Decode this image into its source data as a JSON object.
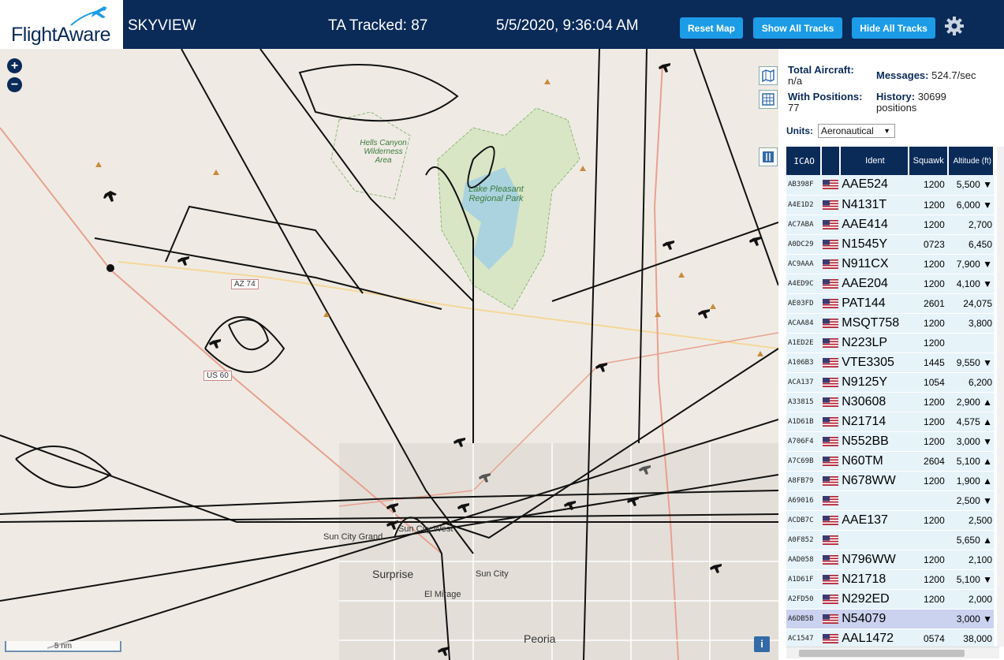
{
  "header": {
    "logo_text": "FlightAware",
    "app_title": "SKYVIEW",
    "tracked": "TA Tracked: 87",
    "clock": "5/5/2020, 9:36:04 AM",
    "buttons": {
      "reset": "Reset Map",
      "show_all": "Show All Tracks",
      "hide_all": "Hide All Tracks"
    }
  },
  "map": {
    "zoom_in": "+",
    "zoom_out": "−",
    "scale": "5 nm",
    "info": "i",
    "labels": {
      "hells_canyon": "Hells Canyon Wilderness Area",
      "lake_pleasant": "Lake Pleasant Regional Park",
      "sun_city_grand": "Sun City Grand",
      "sun_city_west": "Sun City West",
      "surprise": "Surprise",
      "sun_city": "Sun City",
      "el_mirage": "El Mirage",
      "peoria": "Peoria",
      "az74": "AZ 74",
      "us60": "US 60"
    }
  },
  "stats": {
    "total_label": "Total Aircraft:",
    "total_value": "n/a",
    "messages_label": "Messages:",
    "messages_value": "524.7/sec",
    "positions_label": "With Positions:",
    "positions_value": "77",
    "history_label": "History:",
    "history_value": "30699 positions"
  },
  "units": {
    "label": "Units:",
    "selected": "Aeronautical"
  },
  "table": {
    "columns": [
      "ICAO",
      "Ident",
      "Squawk",
      "Altitude (ft)"
    ],
    "rows": [
      {
        "icao": "AB398F",
        "ident": "AAE524",
        "squawk": "1200",
        "alt": "5,500 ▼"
      },
      {
        "icao": "A4E1D2",
        "ident": "N4131T",
        "squawk": "1200",
        "alt": "6,000 ▼"
      },
      {
        "icao": "AC7ABA",
        "ident": "AAE414",
        "squawk": "1200",
        "alt": "2,700"
      },
      {
        "icao": "A0DC29",
        "ident": "N1545Y",
        "squawk": "0723",
        "alt": "6,450"
      },
      {
        "icao": "AC9AAA",
        "ident": "N911CX",
        "squawk": "1200",
        "alt": "7,900 ▼"
      },
      {
        "icao": "A4ED9C",
        "ident": "AAE204",
        "squawk": "1200",
        "alt": "4,100 ▼"
      },
      {
        "icao": "AE03FD",
        "ident": "PAT144",
        "squawk": "2601",
        "alt": "24,075"
      },
      {
        "icao": "ACAA84",
        "ident": "MSQT758",
        "squawk": "1200",
        "alt": "3,800"
      },
      {
        "icao": "A1ED2E",
        "ident": "N223LP",
        "squawk": "1200",
        "alt": ""
      },
      {
        "icao": "A106B3",
        "ident": "VTE3305",
        "squawk": "1445",
        "alt": "9,550 ▼"
      },
      {
        "icao": "ACA137",
        "ident": "N9125Y",
        "squawk": "1054",
        "alt": "6,200"
      },
      {
        "icao": "A33815",
        "ident": "N30608",
        "squawk": "1200",
        "alt": "2,900 ▲"
      },
      {
        "icao": "A1D61B",
        "ident": "N21714",
        "squawk": "1200",
        "alt": "4,575 ▲"
      },
      {
        "icao": "A706F4",
        "ident": "N552BB",
        "squawk": "1200",
        "alt": "3,000 ▼"
      },
      {
        "icao": "A7C69B",
        "ident": "N60TM",
        "squawk": "2604",
        "alt": "5,100 ▲"
      },
      {
        "icao": "A8FB79",
        "ident": "N678WW",
        "squawk": "1200",
        "alt": "1,900 ▲"
      },
      {
        "icao": "A69016",
        "ident": "",
        "squawk": "",
        "alt": "2,500 ▼"
      },
      {
        "icao": "ACDB7C",
        "ident": "AAE137",
        "squawk": "1200",
        "alt": "2,500"
      },
      {
        "icao": "A0F852",
        "ident": "",
        "squawk": "",
        "alt": "5,650 ▲"
      },
      {
        "icao": "AAD058",
        "ident": "N796WW",
        "squawk": "1200",
        "alt": "2,100"
      },
      {
        "icao": "A1D61F",
        "ident": "N21718",
        "squawk": "1200",
        "alt": "5,100 ▼"
      },
      {
        "icao": "A2FD50",
        "ident": "N292ED",
        "squawk": "1200",
        "alt": "2,000"
      },
      {
        "icao": "A6DB5B",
        "ident": "N54079",
        "squawk": "",
        "alt": "3,000 ▼",
        "selected": true
      },
      {
        "icao": "AC1547",
        "ident": "AAL1472",
        "squawk": "0574",
        "alt": "38,000"
      }
    ]
  },
  "colors": {
    "header_bg": "#0a2a58",
    "button": "#1c9ce6",
    "row_bg": "#e6f3f9",
    "row_selected": "#cbd2ef"
  },
  "icons": [
    "plane-icon",
    "gear-icon",
    "map-icon",
    "grid-icon",
    "columns-icon",
    "flag-icon",
    "info-icon"
  ]
}
